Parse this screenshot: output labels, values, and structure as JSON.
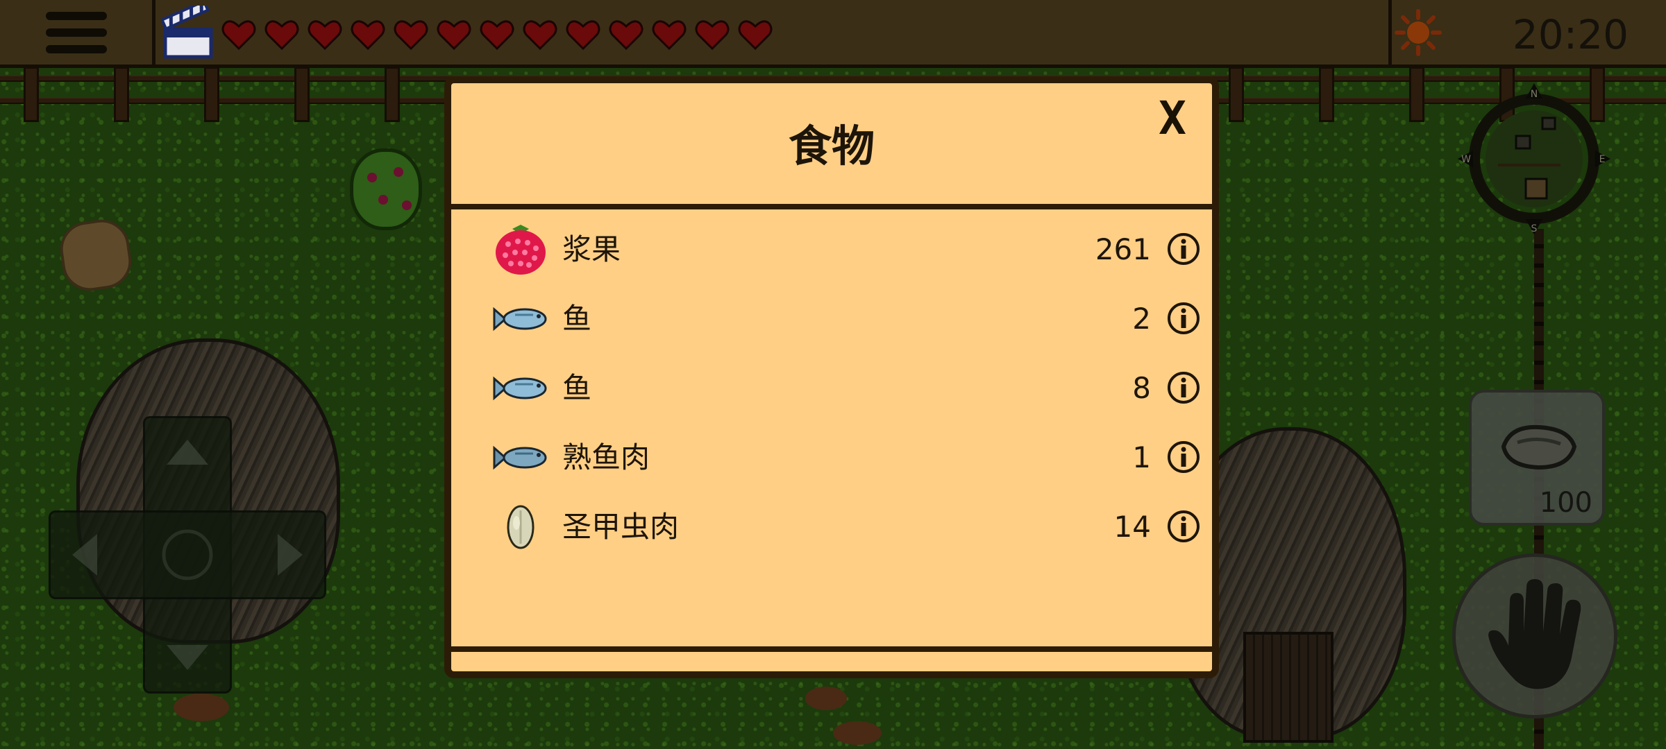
{
  "hud": {
    "menu_icon": "hamburger-menu-icon",
    "ad_icon": "clapperboard-icon",
    "hearts_count": 13,
    "heart_color": "#6b0a0a",
    "weather_icon": "sun-icon",
    "time": "20:20"
  },
  "compass": {
    "icon": "compass-minimap-icon",
    "n": "N",
    "e": "E",
    "s": "S",
    "w": "W"
  },
  "equipped": {
    "icon": "stone-icon",
    "count": "100"
  },
  "interact": {
    "icon": "hand-icon"
  },
  "dpad": {
    "icon": "dpad-icon"
  },
  "food_dialog": {
    "title": "食物",
    "close_label": "X",
    "items": [
      {
        "name": "浆果",
        "qty": "261",
        "icon": "raspberry-icon"
      },
      {
        "name": "鱼",
        "qty": "2",
        "icon": "fish-icon"
      },
      {
        "name": "鱼",
        "qty": "8",
        "icon": "fish-icon"
      },
      {
        "name": "熟鱼肉",
        "qty": "1",
        "icon": "fish-icon"
      },
      {
        "name": "圣甲虫肉",
        "qty": "14",
        "icon": "beetle-meat-icon"
      }
    ],
    "scroll_up_icon": "arrow-up-icon",
    "scroll_down_icon": "arrow-down-icon",
    "scroll_up_enabled": false,
    "scroll_down_enabled": true
  },
  "colors": {
    "dialog_bg": "#ffcf85",
    "dialog_border": "#2c1c07",
    "hud_bg": "#3a2e16",
    "grass": "#1c3a0c"
  }
}
